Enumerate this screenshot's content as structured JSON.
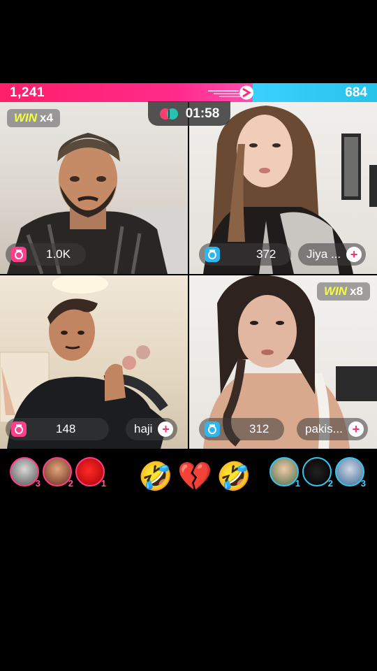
{
  "battle": {
    "left_score": "1,241",
    "right_score": "684",
    "timer": "01:58",
    "colors": {
      "left": "#ff2a7a",
      "right": "#34c5f0",
      "win_text": "#f4ff3a"
    }
  },
  "tiles": [
    {
      "win_word": "WIN",
      "win_mult": "x4",
      "count": "1.0K",
      "icon": "pink-camera-icon"
    },
    {
      "count": "372",
      "name": "Jiya ...",
      "icon": "blue-camera-icon"
    },
    {
      "count": "148",
      "name": "haji",
      "icon": "pink-camera-icon"
    },
    {
      "win_word": "WIN",
      "win_mult": "x8",
      "count": "312",
      "name": "pakis...",
      "icon": "blue-camera-icon"
    }
  ],
  "supporters": {
    "left": [
      {
        "rank": "3"
      },
      {
        "rank": "2"
      },
      {
        "rank": "1"
      }
    ],
    "right": [
      {
        "rank": "1"
      },
      {
        "rank": "2"
      },
      {
        "rank": "3"
      }
    ]
  },
  "reactions": [
    "🤣",
    "💔",
    "🤣"
  ],
  "plus_symbol": "+"
}
